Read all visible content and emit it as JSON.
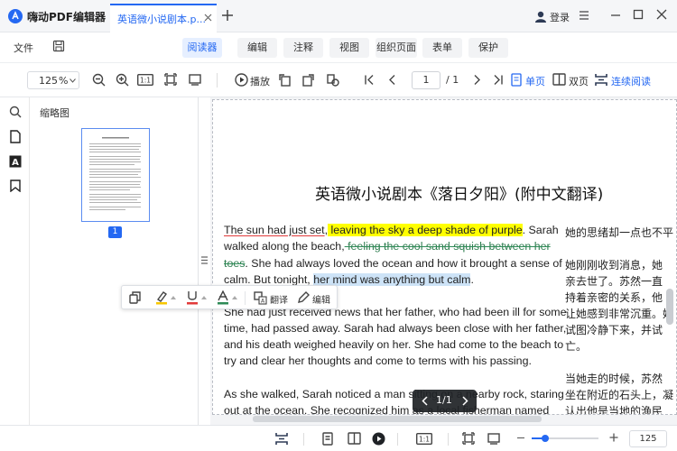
{
  "app": {
    "name": "嗨动PDF编辑器",
    "tab_title": "英语微小说剧本.p...",
    "login_label": "登录"
  },
  "menu": {
    "file_label": "文件",
    "tabs": [
      "阅读器",
      "编辑",
      "注释",
      "视图",
      "组织页面",
      "表单",
      "保护"
    ],
    "active_tab": "阅读器"
  },
  "toolbar": {
    "zoom_value": "125",
    "zoom_unit": "%",
    "play_label": "播放",
    "page_current": "1",
    "page_total": "/ 1",
    "single_page_label": "单页",
    "double_page_label": "双页",
    "continuous_label": "连续阅读"
  },
  "sidebar": {
    "thumbnail_title": "缩略图",
    "thumbnail_page_number": "1"
  },
  "document": {
    "title": "英语微小说剧本《落日夕阳》(附中文翻译)",
    "para1": {
      "l1_a": "The sun had just set",
      "l1_b": ",",
      "l1_c": " leaving the sky a deep shade of purple",
      "l1_d": ". Sarah",
      "l2_a": "walked along the beach,",
      "l2_b": " feeling the cool sand squish between her",
      "l3_a": "toes",
      "l3_b": ". She had always loved the ocean and how it brought a sense of",
      "l4_a": "calm. But tonight, ",
      "l4_b": "her mind was anything but calm",
      "l4_c": "."
    },
    "para2": [
      "She had just received news that her father, who had been ill for some",
      "time, had passed away. Sarah had always been close with her father,",
      "and his death weighed heavily on her. She had come to the beach to",
      "try and clear her thoughts and come to terms with his passing."
    ],
    "para3": [
      "As she walked, Sarah noticed a man sitting on a nearby rock, staring",
      "out at the ocean. She recognized him as a local fisherman named"
    ],
    "chinese": [
      "她的思绪却一点也不平",
      "她刚刚收到消息，她",
      "亲去世了。苏然一直",
      "持着亲密的关系，他",
      "让她感到非常沉重。她",
      "试图冷静下来，并试",
      "亡。",
      "当她走的时候，苏然",
      "坐在附近的石头上，凝",
      "认出他是当地的渔民"
    ]
  },
  "float_toolbar": {
    "translate_label": "翻译",
    "edit_label": "编辑"
  },
  "page_badge": "1/1",
  "statusbar": {
    "zoom_value": "125"
  },
  "colors": {
    "accent": "#2468f2",
    "highlight_yellow": "#ffff00",
    "highlight_blue": "#cde3f7",
    "underline_red": "#e23b3b",
    "strike_green": "#2e8b57"
  }
}
